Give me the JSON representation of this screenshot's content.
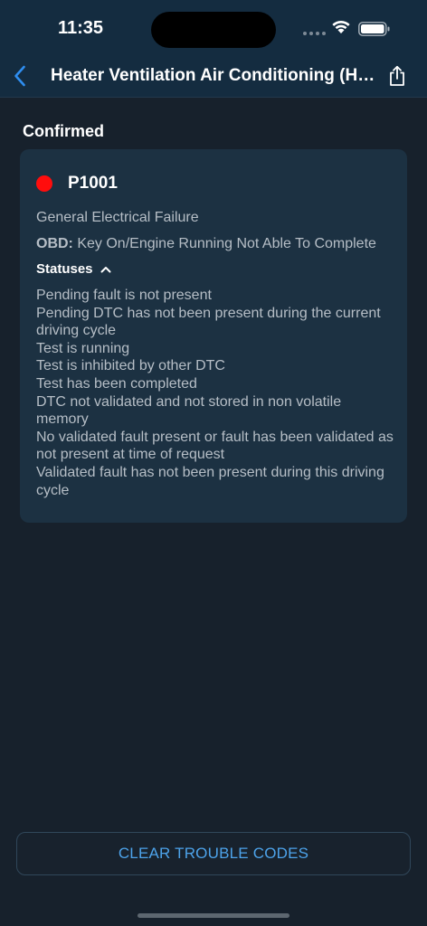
{
  "status_bar": {
    "time": "11:35",
    "wifi_icon": "wifi-icon",
    "battery_icon": "battery-icon"
  },
  "nav": {
    "title": "Heater Ventilation Air Conditioning (HV...",
    "back_icon": "chevron-left-icon",
    "share_icon": "share-icon"
  },
  "section": {
    "title": "Confirmed"
  },
  "dtc": {
    "code": "P1001",
    "indicator_color": "#ff0d0d",
    "description": "General Electrical Failure",
    "obd_label": "OBD:",
    "obd_value": "Key On/Engine Running Not Able To Complete",
    "statuses_label": "Statuses",
    "statuses": [
      "Pending fault is not present",
      "Pending DTC has not been present during the current driving cycle",
      "Test is running",
      "Test is inhibited by other DTC",
      "Test has been completed",
      "DTC not validated and not stored in non volatile memory",
      "No validated fault present or fault has been validated as not present at time of request",
      "Validated fault has not been present during this driving cycle"
    ]
  },
  "actions": {
    "clear_label": "CLEAR TROUBLE CODES"
  },
  "colors": {
    "accent": "#4da3ea",
    "background": "#17212c",
    "card": "#1c3142",
    "header": "#142c40"
  }
}
